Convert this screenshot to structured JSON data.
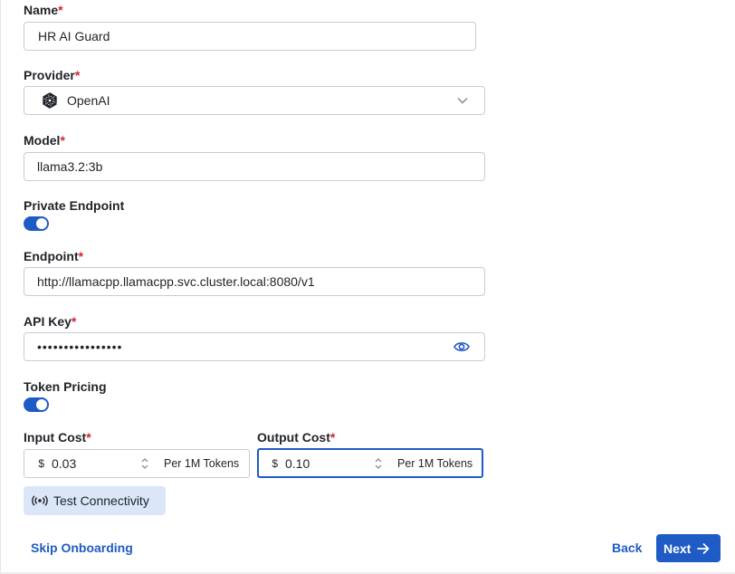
{
  "form": {
    "name": {
      "label": "Name",
      "required": "*",
      "value": "HR AI Guard"
    },
    "provider": {
      "label": "Provider",
      "required": "*",
      "value": "OpenAI",
      "icon": "openai-logo-icon"
    },
    "model": {
      "label": "Model",
      "required": "*",
      "value": "llama3.2:3b"
    },
    "private_endpoint": {
      "label": "Private Endpoint",
      "enabled": true
    },
    "endpoint": {
      "label": "Endpoint",
      "required": "*",
      "value": "http://llamacpp.llamacpp.svc.cluster.local:8080/v1"
    },
    "api_key": {
      "label": "API Key",
      "required": "*",
      "masked_value": "••••••••••••••••",
      "icon": "eye-icon"
    },
    "token_pricing": {
      "label": "Token Pricing",
      "enabled": true
    },
    "input_cost": {
      "label": "Input Cost",
      "required": "*",
      "currency": "$",
      "value": "0.03",
      "unit": "Per 1M Tokens"
    },
    "output_cost": {
      "label": "Output Cost",
      "required": "*",
      "currency": "$",
      "value": "0.10",
      "unit": "Per 1M Tokens"
    }
  },
  "actions": {
    "test_connectivity": "Test Connectivity",
    "skip_onboarding": "Skip Onboarding",
    "back": "Back",
    "next": "Next"
  },
  "colors": {
    "accent": "#1f5bc4",
    "required": "#d1242f",
    "test_button_bg": "#dbe6f8"
  }
}
